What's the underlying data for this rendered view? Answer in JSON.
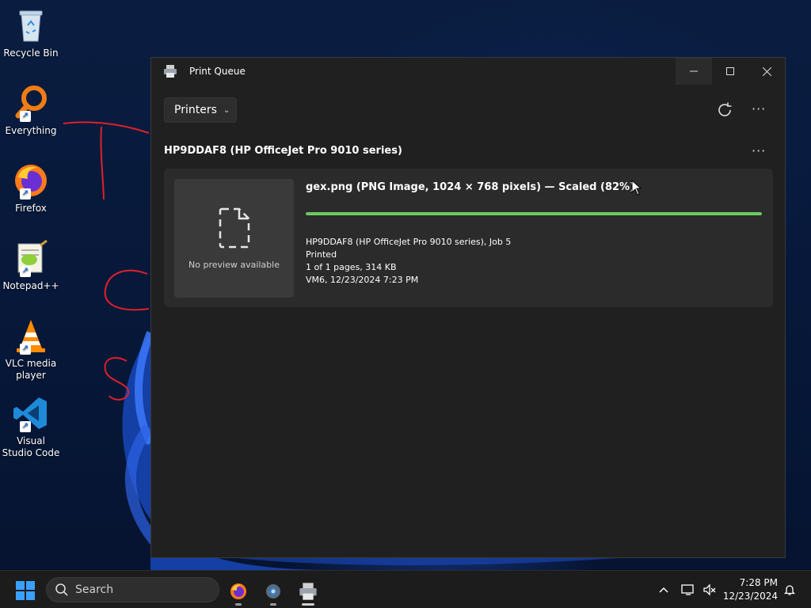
{
  "desktop": {
    "icons": [
      {
        "label": "Recycle Bin",
        "icon": "recycle-bin-icon",
        "shortcut": false
      },
      {
        "label": "Everything",
        "icon": "everything-search-icon",
        "shortcut": true
      },
      {
        "label": "Firefox",
        "icon": "firefox-icon",
        "shortcut": true
      },
      {
        "label": "Notepad++",
        "icon": "notepadpp-icon",
        "shortcut": true
      },
      {
        "label": "VLC media player",
        "icon": "vlc-icon",
        "shortcut": true
      },
      {
        "label": "Visual Studio Code",
        "icon": "vscode-icon",
        "shortcut": true
      }
    ],
    "annotation_color": "#e0202a"
  },
  "window": {
    "title": "Print Queue",
    "toolbar": {
      "printers_label": "Printers"
    },
    "printer": {
      "name": "HP9DDAF8 (HP OfficeJet Pro 9010 series)"
    },
    "job": {
      "title": "gex.png (PNG Image, 1024 × 768 pixels) — Scaled (82%)",
      "preview_text": "No preview available",
      "progress": 1.0,
      "progress_color": "#6ccb5f",
      "meta": {
        "job_line": "HP9DDAF8 (HP OfficeJet Pro 9010 series), Job 5",
        "status": "Printed",
        "pages_size": "1 of 1 pages, 314 KB",
        "owner_time": "VM6, 12/23/2024 7:23 PM"
      }
    }
  },
  "taskbar": {
    "search_label": "Search",
    "clock": {
      "time": "7:28 PM",
      "date": "12/23/2024"
    }
  },
  "colors": {
    "window_bg": "#202020",
    "card_bg": "#2b2b2b",
    "accent_windows": "#3aa0ff"
  }
}
